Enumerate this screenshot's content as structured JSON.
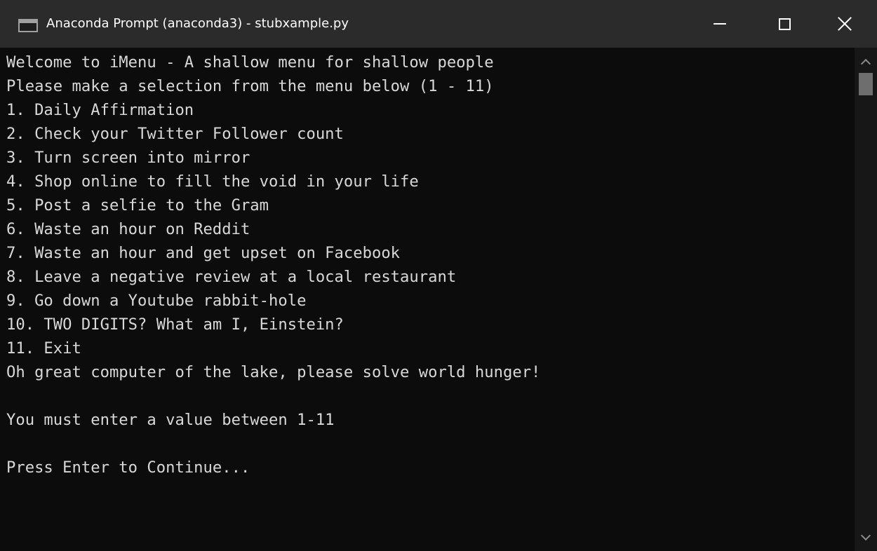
{
  "window": {
    "title": "Anaconda Prompt (anaconda3) - stubxample.py",
    "icon": "console-window-icon",
    "controls": {
      "minimize": "minimize-icon",
      "maximize": "maximize-icon",
      "close": "close-icon"
    }
  },
  "console": {
    "lines": [
      "Welcome to iMenu - A shallow menu for shallow people",
      "Please make a selection from the menu below (1 - 11)",
      "1. Daily Affirmation",
      "2. Check your Twitter Follower count",
      "3. Turn screen into mirror",
      "4. Shop online to fill the void in your life",
      "5. Post a selfie to the Gram",
      "6. Waste an hour on Reddit",
      "7. Waste an hour and get upset on Facebook",
      "8. Leave a negative review at a local restaurant",
      "9. Go down a Youtube rabbit-hole",
      "10. TWO DIGITS? What am I, Einstein?",
      "11. Exit",
      "Oh great computer of the lake, please solve world hunger!",
      "",
      "You must enter a value between 1-11",
      "",
      "Press Enter to Continue..."
    ]
  },
  "scrollbar": {
    "up_icon": "chevron-up-icon",
    "down_icon": "chevron-down-icon"
  },
  "colors": {
    "console_bg": "#0c0c0c",
    "console_text": "#d8d8d8",
    "titlebar_bg": "#2b2b2b",
    "titlebar_text": "#ffffff"
  }
}
